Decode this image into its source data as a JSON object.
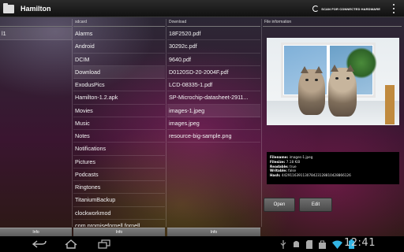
{
  "app": {
    "title": "Hamilton",
    "scan_action": "SCAN FOR CONNECTED HARDWARE",
    "icons": {
      "app": "folder-icon",
      "scan": "refresh-icon",
      "overflow": "overflow-menu-icon"
    }
  },
  "columns": {
    "col1_header": "",
    "col2_header": "sdcard",
    "col3_header": "Download",
    "info_header": "File information"
  },
  "col1": {
    "items": [
      "l1"
    ]
  },
  "sdcard": {
    "items": [
      "Alarms",
      "Android",
      "DCIM",
      "Download",
      "ExodusPics",
      "Hamilton-1.2.apk",
      "Movies",
      "Music",
      "Notes",
      "Notifications",
      "Pictures",
      "Podcasts",
      "Ringtones",
      "TitaniumBackup",
      "clockworkmod",
      "com.promisefornell.fornell"
    ]
  },
  "download": {
    "items": [
      "18F2520.pdf",
      "30292c.pdf",
      "9640.pdf",
      "D0120SD-20-2004F.pdf",
      "LCD-08335-1.pdf",
      "SP-Microchip-datasheet-2911...",
      "images-1.jpeg",
      "images.jpeg",
      "resource-big-sample.png"
    ]
  },
  "file_info": {
    "filename_label": "Filename:",
    "filename": "images-1.jpeg",
    "filesize_label": "Filesize:",
    "filesize": "7.18 KiB",
    "readable_label": "Readable:",
    "readable": "true",
    "writable_label": "Writable:",
    "writable": "false",
    "hash_label": "Hash:",
    "hash": "442911639113078423128810428866126"
  },
  "buttons": {
    "open": "Open",
    "edit": "Edit"
  },
  "info_tabs": {
    "t1": "Info",
    "t2": "Info",
    "t3": "Info"
  },
  "system_bar": {
    "time": "12:41",
    "icons": [
      "back-icon",
      "home-icon",
      "recents-icon",
      "usb-icon",
      "android-debug-icon",
      "sd-card-icon",
      "bag-icon",
      "wifi-icon",
      "battery-icon"
    ]
  }
}
